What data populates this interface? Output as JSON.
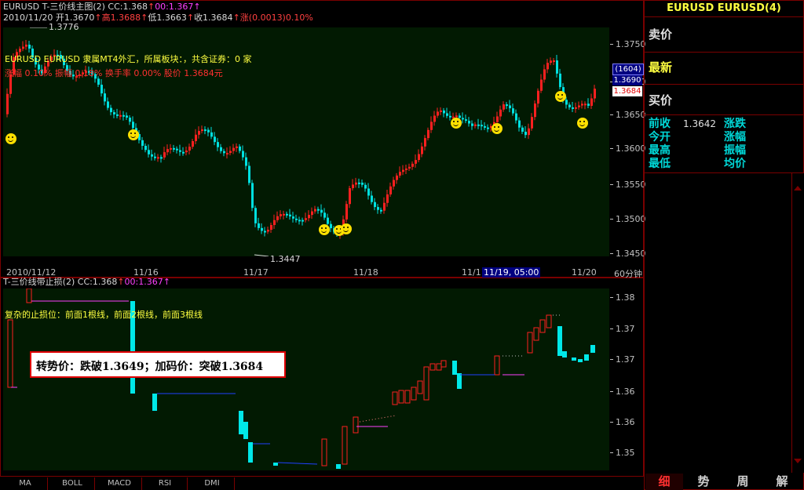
{
  "main_chart": {
    "title_parts": [
      {
        "text": "EURUSD T-三价线主图(2)",
        "color": "#d8d8d8"
      },
      {
        "text": " CC:1.368",
        "color": "#d8d8d8"
      },
      {
        "text": "↑",
        "color": "#ff4040"
      },
      {
        "text": "00:1.367",
        "color": "#ff40ff"
      },
      {
        "text": "↑",
        "color": "#ff40ff"
      }
    ],
    "quote_parts": [
      {
        "text": "2010/11/20",
        "color": "#d8d8d8"
      },
      {
        "text": " 开1.3670",
        "color": "#d8d8d8"
      },
      {
        "text": "↑",
        "color": "#ff4040"
      },
      {
        "text": "高1.3688",
        "color": "#ff4040"
      },
      {
        "text": "↑",
        "color": "#ff4040"
      },
      {
        "text": "低1.3663",
        "color": "#d8d8d8"
      },
      {
        "text": "↑",
        "color": "#ff4040"
      },
      {
        "text": "收1.3684",
        "color": "#d8d8d8"
      },
      {
        "text": "↑",
        "color": "#ff4040"
      },
      {
        "text": "涨(0.0013)0.10%",
        "color": "#ff4040"
      }
    ],
    "high_label": "1.3776",
    "low_label": "1.3447",
    "info_line1": "EURUSD EURUSD 隶属MT4外汇，所属板块：，共含证券：0 家",
    "info_line2": "涨幅 0.10% 振幅 0.18% 换手率 0.00% 股价 1.3684元",
    "y_labels": [
      "1.3750",
      "1.3700",
      "1.3650",
      "1.3600",
      "1.3550",
      "1.3500",
      "1.3450"
    ],
    "price_tags": {
      "count": "(1604)",
      "upper": "1.3690",
      "current": "1.3684"
    },
    "x_labels": [
      "2010/11/12",
      "11/16",
      "11/17",
      "11/18",
      "11/1",
      "11/20"
    ],
    "crosshair_time": "11/19, 05:00",
    "period": "60分钟"
  },
  "sub_chart": {
    "title_parts": [
      {
        "text": "T-三价线带止损(2)",
        "color": "#d8d8d8"
      },
      {
        "text": " CC:1.368",
        "color": "#d8d8d8"
      },
      {
        "text": "↑",
        "color": "#ff4040"
      },
      {
        "text": "00:1.367",
        "color": "#ff40ff"
      },
      {
        "text": "↑",
        "color": "#ff40ff"
      }
    ],
    "note": "复杂的止损位：前面1根线，前面2根线，前面3根线",
    "signal_box": "转势价：跌破1.3649；加码价：突破1.3684",
    "y_labels": [
      "1.38",
      "1.37",
      "1.37",
      "1.36",
      "1.36",
      "1.35"
    ]
  },
  "bottom_tabs": [
    "MA",
    "BOLL",
    "MACD",
    "RSI",
    "DMI"
  ],
  "right_panel": {
    "symbol": "EURUSD EURUSD(4)",
    "sell": "卖价",
    "latest": "最新",
    "buy": "买价",
    "rows": [
      {
        "label": "前收",
        "value": "1.3642",
        "label2": "涨跌"
      },
      {
        "label": "今开",
        "value": "",
        "label2": "涨幅"
      },
      {
        "label": "最高",
        "value": "",
        "label2": "振幅"
      },
      {
        "label": "最低",
        "value": "",
        "label2": "均价"
      }
    ],
    "tabs": [
      "细",
      "势",
      "周",
      "解"
    ]
  },
  "colors": {
    "up": "#ff2020",
    "down": "#00e0e0",
    "grid_bg": "#021a02",
    "frame": "#7a0000"
  }
}
